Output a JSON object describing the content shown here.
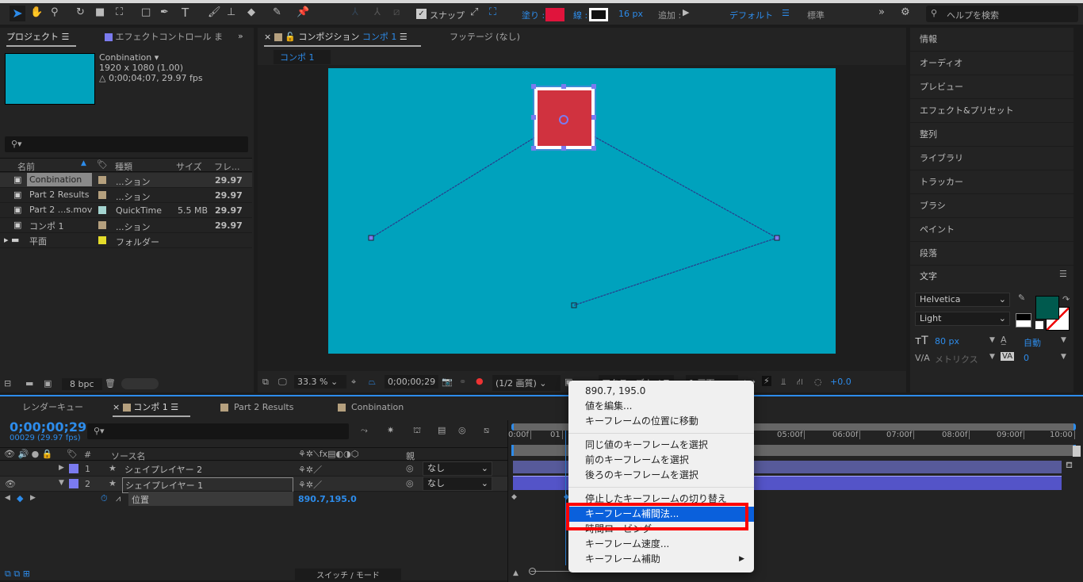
{
  "toolbar": {
    "snap_label": "スナップ",
    "fill_label": "塗り :",
    "fill_color": "#e0143c",
    "stroke_label": "線 :",
    "stroke_width": "16 px",
    "add_label": "追加 :",
    "workspace_default": "デフォルト",
    "workspace_standard": "標準",
    "help_search_placeholder": "ヘルプを検索",
    "tools": [
      "selection-tool",
      "hand-tool",
      "zoom-tool",
      "rotation-tool",
      "camera-tool",
      "pan-behind-tool",
      "rectangle-tool",
      "pen-tool",
      "type-tool",
      "brush-tool",
      "clone-stamp-tool",
      "eraser-tool",
      "roto-brush-tool",
      "puppet-pin-tool"
    ]
  },
  "project": {
    "tab_project": "プロジェクト",
    "tab_effects": "エフェクトコントロール ま",
    "preview": {
      "name": "Conbination ▾",
      "resolution": "1920 x 1080 (1.00)",
      "duration": "△ 0;00;04;07, 29.97 fps",
      "color": "#00a2bd"
    },
    "columns": {
      "name": "名前",
      "type": "種類",
      "size": "サイズ",
      "fps": "フレ..."
    },
    "items": [
      {
        "name": "Conbination",
        "label_color": "#b5a07e",
        "type": "...ション",
        "size": "",
        "fps": "29.97",
        "icon": "composition-icon",
        "selected": true
      },
      {
        "name": "Part 2 Results",
        "label_color": "#b5a07e",
        "type": "...ション",
        "size": "",
        "fps": "29.97",
        "icon": "composition-icon"
      },
      {
        "name": "Part 2 ...s.mov",
        "label_color": "#a4d4d0",
        "type": "QuickTime",
        "size": "5.5 MB",
        "fps": "29.97",
        "icon": "quicktime-file-icon"
      },
      {
        "name": "コンポ 1",
        "label_color": "#b5a07e",
        "type": "...ション",
        "size": "",
        "fps": "29.97",
        "icon": "composition-icon"
      },
      {
        "name": "平面",
        "label_color": "#e4dc2a",
        "type": "フォルダー",
        "size": "",
        "fps": "",
        "icon": "folder-icon"
      }
    ],
    "bpc": "8 bpc"
  },
  "composition": {
    "tab_label": "コンポジション",
    "tab_comp_name": "コンポ 1",
    "tab_footage": "フッテージ (なし)",
    "subtab": "コンポ 1",
    "canvas_color": "#00a2bd",
    "shape_color": "#d0323f",
    "zoom": "33.3 %",
    "timecode": "0;00;00;29",
    "resolution": "(1/2 画質)",
    "camera": "アクティブカメラ",
    "views": "1 画面",
    "exposure": "+0.0"
  },
  "right_panel": {
    "items": [
      "情報",
      "オーディオ",
      "プレビュー",
      "エフェクト&プリセット",
      "整列",
      "ライブラリ",
      "トラッカー",
      "ブラシ",
      "ペイント",
      "段落"
    ],
    "character": {
      "title": "文字",
      "font": "Helvetica",
      "style": "Light",
      "size": "80 px",
      "leading": "自動",
      "kerning": "メトリクス",
      "tracking": "0",
      "fill_color": "#005a4e"
    }
  },
  "timeline": {
    "tab_render": "レンダーキュー",
    "tab_comp": "コンポ 1",
    "tab_part2": "Part 2 Results",
    "tab_conbination": "Conbination",
    "timecode": "0;00;00;29",
    "frame_info": "00029 (29.97 fps)",
    "columns": {
      "num": "#",
      "source": "ソース名",
      "parent": "親"
    },
    "layers": [
      {
        "num": "1",
        "name": "シェイプレイヤー 2",
        "parent": "なし",
        "color": "#7b7bef",
        "expanded": false
      },
      {
        "num": "2",
        "name": "シェイプレイヤー 1",
        "parent": "なし",
        "color": "#7b7bef",
        "expanded": true
      }
    ],
    "property": {
      "name": "位置",
      "value": "890.7,195.0"
    },
    "ruler": [
      "0:00f",
      "01",
      "05:00f",
      "06:00f",
      "07:00f",
      "08:00f",
      "09:00f",
      "10:00"
    ],
    "switch_mode": "スイッチ / モード"
  },
  "context_menu": {
    "items": [
      {
        "label": "890.7, 195.0"
      },
      {
        "label": "値を編集..."
      },
      {
        "label": "キーフレームの位置に移動"
      },
      {
        "sep": true
      },
      {
        "label": "同じ値のキーフレームを選択"
      },
      {
        "label": "前のキーフレームを選択"
      },
      {
        "label": "後ろのキーフレームを選択"
      },
      {
        "sep": true
      },
      {
        "label": "停止したキーフレームの切り替え"
      },
      {
        "label": "キーフレーム補間法...",
        "highlighted": true
      },
      {
        "label": "時間ロービング"
      },
      {
        "label": "キーフレーム速度..."
      },
      {
        "label": "キーフレーム補助",
        "submenu": true
      }
    ],
    "highlight_color": "#0a60dc",
    "annotation_color": "#ff0000"
  }
}
